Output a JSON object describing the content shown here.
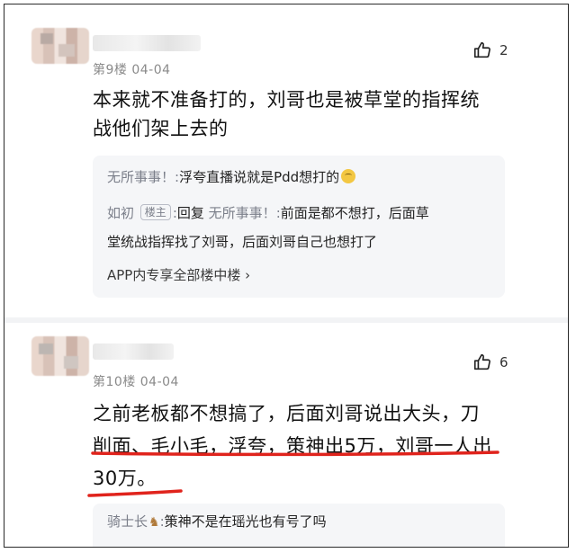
{
  "post1": {
    "meta": "第9楼  04-04",
    "likes": "2",
    "body_line1": "本来就不准备打的，刘哥也是被草堂的指挥统",
    "body_line2": "战他们架上去的",
    "replies": [
      {
        "name": "无所事事！",
        "sep": ":",
        "text": "浮夸直播说就是Pdd想打的"
      },
      {
        "name": "如初",
        "badge": "楼主",
        "sep": ":",
        "reply_word": "回复",
        "target": "无所事事！",
        "sep2": ":",
        "text": "前面是都不想打，后面草"
      },
      {
        "text": "堂统战指挥找了刘哥，后面刘哥自己也想打了"
      }
    ],
    "more_link": "APP内专享全部楼中楼 ›"
  },
  "post2": {
    "meta": "第10楼  04-04",
    "likes": "6",
    "body_line1": "之前老板都不想搞了，后面刘哥说出大头，刀",
    "body_line2": "削面、毛小毛，浮夸，策神出5万，刘哥一人出",
    "body_line3": "30万。",
    "replies": [
      {
        "name": "骑士长",
        "sep": ":",
        "text": "策神不是在瑶光也有号了吗"
      }
    ]
  },
  "colors": {
    "annotation_red": "#e0231c",
    "reply_bg": "#f5f6f8",
    "meta_gray": "#8a8a8a"
  },
  "icons": {
    "like": "thumbs-up-icon",
    "emoji": "grimace-emoji-icon",
    "horse": "horse-emoji-icon"
  }
}
